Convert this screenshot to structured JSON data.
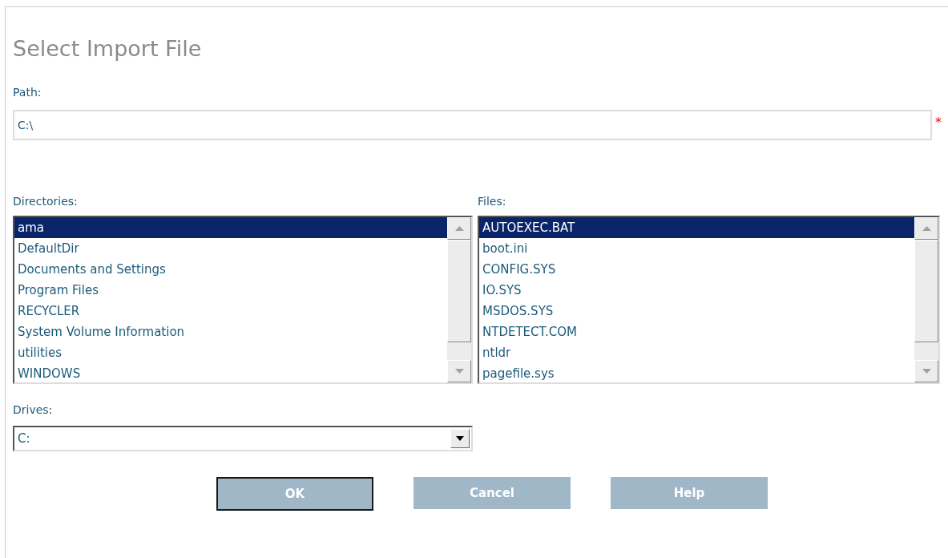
{
  "title": "Select Import File",
  "path": {
    "label": "Path:",
    "value": "C:\\",
    "required": true,
    "required_mark": "*"
  },
  "directories": {
    "label": "Directories:",
    "items": [
      {
        "name": "ama",
        "selected": true
      },
      {
        "name": "DefaultDir",
        "selected": false
      },
      {
        "name": "Documents and Settings",
        "selected": false
      },
      {
        "name": "Program Files",
        "selected": false
      },
      {
        "name": "RECYCLER",
        "selected": false
      },
      {
        "name": "System Volume Information",
        "selected": false
      },
      {
        "name": "utilities",
        "selected": false
      },
      {
        "name": "WINDOWS",
        "selected": false
      }
    ]
  },
  "files": {
    "label": "Files:",
    "items": [
      {
        "name": "AUTOEXEC.BAT",
        "selected": true
      },
      {
        "name": "boot.ini",
        "selected": false
      },
      {
        "name": "CONFIG.SYS",
        "selected": false
      },
      {
        "name": "IO.SYS",
        "selected": false
      },
      {
        "name": "MSDOS.SYS",
        "selected": false
      },
      {
        "name": "NTDETECT.COM",
        "selected": false
      },
      {
        "name": "ntldr",
        "selected": false
      },
      {
        "name": "pagefile.sys",
        "selected": false
      }
    ]
  },
  "drives": {
    "label": "Drives:",
    "value": "C:"
  },
  "buttons": [
    {
      "label": "OK",
      "default": true
    },
    {
      "label": "Cancel",
      "default": false
    },
    {
      "label": "Help",
      "default": false
    }
  ]
}
